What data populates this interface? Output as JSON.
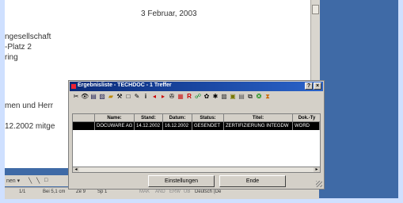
{
  "document": {
    "date_line": "3 Februar, 2003",
    "lines": [
      "ngesellschaft",
      "-Platz 2",
      "ring",
      "men und Herr",
      "12.2002 mitge"
    ]
  },
  "drawbar": {
    "label": "nen ▾",
    "icons": [
      "╲",
      "╲",
      "□"
    ]
  },
  "statusbar": {
    "page": "1/1",
    "position": "Bei 5,1 cm",
    "line": "Ze 9",
    "column": "Sp 1",
    "modes": [
      "MAK",
      "ÄND",
      "ERW",
      "ÜB"
    ],
    "language": "Deutsch (De"
  },
  "dialog": {
    "title": "Ergebnisliste - TECHDOC - 1 Treffer",
    "title_buttons": [
      "?",
      "×"
    ],
    "columns": [
      "Name:",
      "Stand:",
      "Datum:",
      "Status:",
      "Titel:",
      "Dok.-Ty"
    ],
    "rows": [
      [
        "DOCUWARE AG",
        "14.12.2002",
        "16.12.2002",
        "GESENDET",
        "ZERTIFIZIERUNG INTEGDW",
        "WORD"
      ]
    ],
    "buttons": {
      "settings": "Einstellungen",
      "end": "Ende"
    },
    "colors": {
      "title_start": "#0a2a78",
      "title_end": "#2a63c9",
      "row_selected": "#000000"
    }
  }
}
